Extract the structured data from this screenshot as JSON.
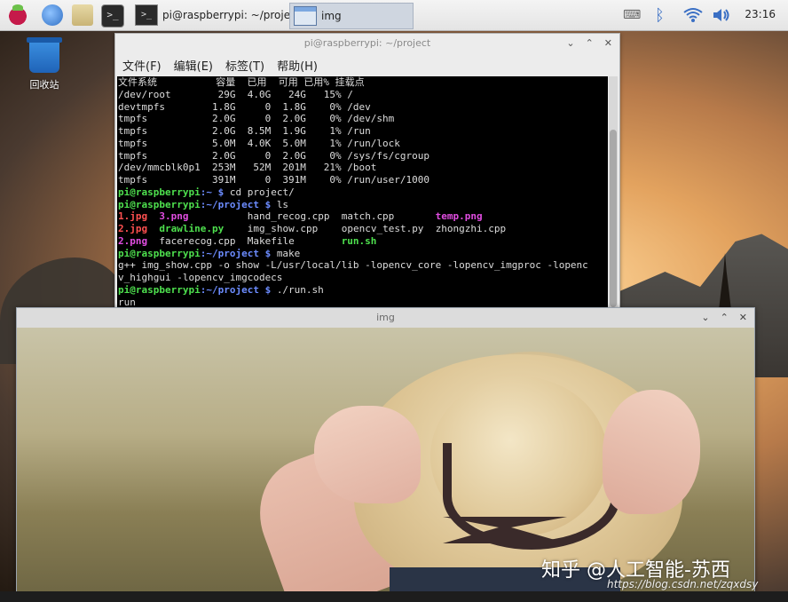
{
  "taskbar": {
    "tasks": [
      {
        "label": "pi@raspberrypi: ~/project",
        "icon": "terminal-icon"
      },
      {
        "label": "img",
        "icon": "image-window-icon"
      }
    ],
    "clock": "23:16"
  },
  "desktop": {
    "trash_label": "回收站"
  },
  "terminal": {
    "title": "pi@raspberrypi: ~/project",
    "menu": [
      "文件(F)",
      "编辑(E)",
      "标签(T)",
      "帮助(H)"
    ],
    "df_header": "文件系统          容量  已用  可用 已用% 挂载点",
    "df_rows": [
      "/dev/root        29G  4.0G   24G   15% /",
      "devtmpfs        1.8G     0  1.8G    0% /dev",
      "tmpfs           2.0G     0  2.0G    0% /dev/shm",
      "tmpfs           2.0G  8.5M  1.9G    1% /run",
      "tmpfs           5.0M  4.0K  5.0M    1% /run/lock",
      "tmpfs           2.0G     0  2.0G    0% /sys/fs/cgroup",
      "/dev/mmcblk0p1  253M   52M  201M   21% /boot",
      "tmpfs           391M     0  391M    0% /run/user/1000"
    ],
    "prompt_user": "pi@raspberrypi",
    "home_path": ":~ $ ",
    "project_path": ":~/project $ ",
    "cmd_cd": "cd project/",
    "cmd_ls": "ls",
    "ls_row1": [
      "1.jpg",
      "3.png",
      "hand_recog.cpp",
      "match.cpp",
      "temp.png"
    ],
    "ls_row2": [
      "2.jpg",
      "drawline.py",
      "img_show.cpp",
      "opencv_test.py",
      "zhongzhi.cpp"
    ],
    "ls_row3": [
      "2.png",
      "facerecog.cpp",
      "Makefile",
      "run.sh"
    ],
    "cmd_make": "make",
    "make_out1": "g++ img_show.cpp -o show -L/usr/local/lib -lopencv_core -lopencv_imgproc -lopenc",
    "make_out2": "v_highgui -lopencv_imgcodecs",
    "cmd_run": "./run.sh",
    "run_out": "run"
  },
  "img_window": {
    "title": "img"
  },
  "watermark": {
    "text": "知乎 @人工智能-苏西",
    "url": "https://blog.csdn.net/zqxdsy"
  }
}
